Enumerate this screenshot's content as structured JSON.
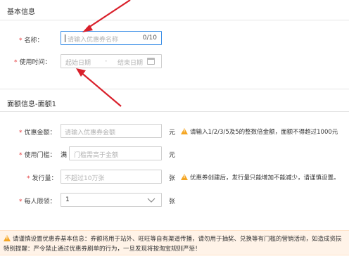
{
  "basic_info": {
    "title": "基本信息",
    "name_label": "名称：",
    "name_placeholder": "请输入优惠券名称",
    "name_counter": "0/10",
    "time_label": "使用时间：",
    "start_placeholder": "起始日期",
    "separator": "-",
    "end_placeholder": "结束日期",
    "calendar_icon": "calendar-icon"
  },
  "denomination": {
    "title": "面额信息-面额1",
    "amount_label": "优惠金额：",
    "amount_placeholder": "请输入优惠券金额",
    "amount_unit": "元",
    "amount_hint": "请输入1/2/3/5及5的整数倍金额，面额不得超过1000元",
    "threshold_label": "使用门槛：",
    "threshold_prefix": "满",
    "threshold_placeholder": "门槛需高于金额",
    "threshold_unit": "元",
    "quantity_label": "发行量：",
    "quantity_placeholder": "不超过10万张",
    "quantity_unit": "张",
    "quantity_hint": "优惠券创建后，发行量只能增加不能减少，请谨慎设置。",
    "limit_label": "每人限领：",
    "limit_value": "1",
    "limit_unit": "张"
  },
  "notice": {
    "line1": "请谨慎设置优惠券基本信息：券额将用于站外、旺旺等自有渠道传播，请勿用于抽奖、兑换等有门槛的营销活动，如造成资损",
    "line2": "特别提醒：严令禁止通过优惠券刷单的行为，一旦发现将按淘宝规则严惩！"
  },
  "colors": {
    "required": "#e4393c",
    "arrow": "#d9202b",
    "warning": "#f5a623",
    "active_border": "#3a8ee6"
  }
}
